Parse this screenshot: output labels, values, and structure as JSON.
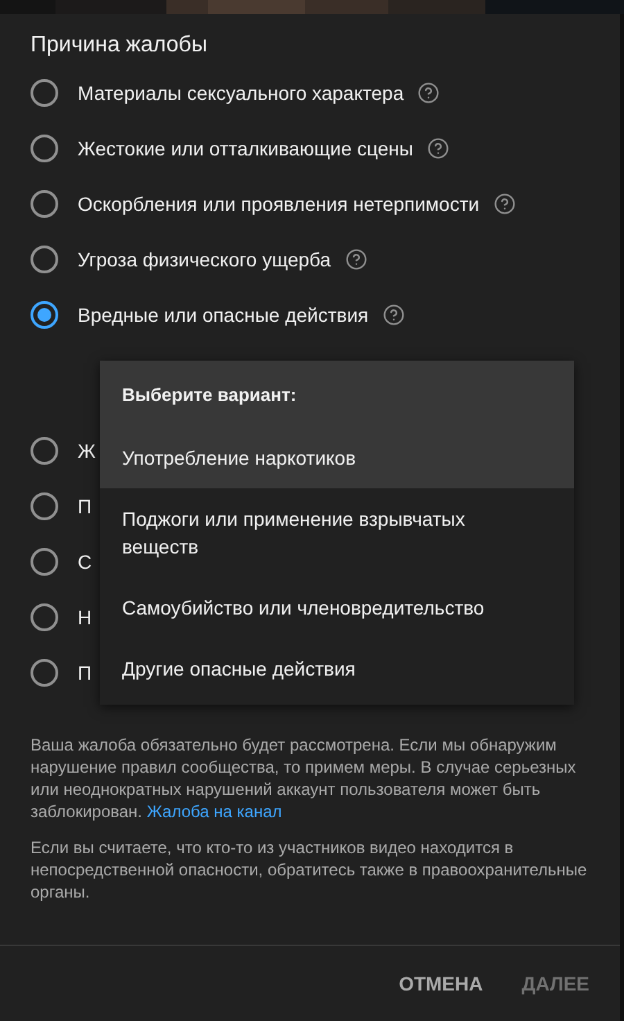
{
  "title": "Причина жалобы",
  "reasons": [
    {
      "label": "Материалы сексуального характера",
      "selected": false,
      "help": true
    },
    {
      "label": "Жестокие или отталкивающие сцены",
      "selected": false,
      "help": true
    },
    {
      "label": "Оскорбления или проявления нетерпимости",
      "selected": false,
      "help": true
    },
    {
      "label": "Угроза физического ущерба",
      "selected": false,
      "help": true
    },
    {
      "label": "Вредные или опасные действия",
      "selected": true,
      "help": true
    },
    {
      "label": "Ж",
      "selected": false,
      "help": false
    },
    {
      "label": "П",
      "selected": false,
      "help": false
    },
    {
      "label": "С",
      "selected": false,
      "help": false
    },
    {
      "label": "Н",
      "selected": false,
      "help": false
    },
    {
      "label": "П",
      "selected": false,
      "help": false
    }
  ],
  "menu": {
    "heading": "Выберите вариант:",
    "items": [
      {
        "label": "Употребление наркотиков",
        "highlighted": true
      },
      {
        "label": "Поджоги или применение взрывчатых веществ",
        "highlighted": false
      },
      {
        "label": "Самоубийство или членовредительство",
        "highlighted": false
      },
      {
        "label": "Другие опасные действия",
        "highlighted": false
      }
    ]
  },
  "notice": {
    "text": "Ваша жалоба обязательно будет рассмотрена. Если мы обнаружим нарушение правил сообщества, то примем меры. В случае серьезных или неоднократных нарушений аккаунт пользователя может быть заблокирован.",
    "link": "Жалоба на канал"
  },
  "note": "Если вы считаете, что кто-то из участников видео находится в непосредственной опасности, обратитесь также в правоохранительные органы.",
  "buttons": [
    {
      "label": "ОТМЕНА",
      "disabled": false
    },
    {
      "label": "ДАЛЕЕ",
      "disabled": true
    }
  ]
}
